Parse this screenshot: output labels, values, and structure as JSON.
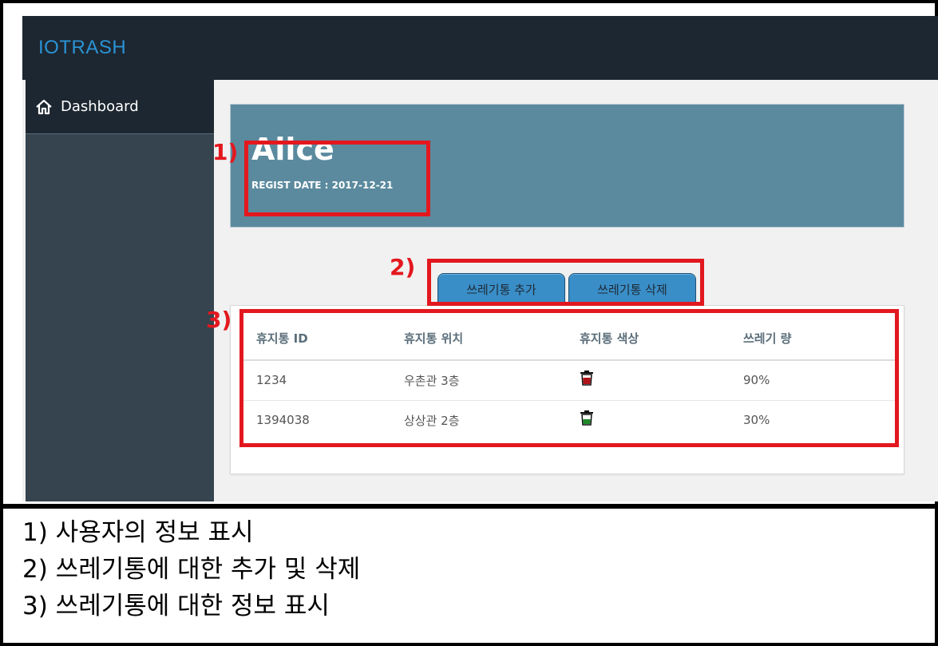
{
  "header": {
    "brand": "IOTRASH"
  },
  "sidebar": {
    "items": [
      {
        "label": "Dashboard",
        "icon": "home-icon"
      }
    ]
  },
  "profile": {
    "name": "Alice",
    "regist_date": "REGIST DATE : 2017-12-21"
  },
  "actions": {
    "add_label": "쓰레기통 추가",
    "delete_label": "쓰레기통 삭제"
  },
  "table": {
    "headers": [
      "휴지통 ID",
      "휴지통 위치",
      "휴지통 색상",
      "쓰레기 량"
    ],
    "rows": [
      {
        "id": "1234",
        "location": "우촌관 3층",
        "color_icon": "trash-bin-red-icon",
        "amount": "90%"
      },
      {
        "id": "1394038",
        "location": "상상관 2층",
        "color_icon": "trash-bin-green-icon",
        "amount": "30%"
      }
    ]
  },
  "annotations": {
    "labels": [
      "1)",
      "2)",
      "3)"
    ]
  },
  "legend": {
    "lines": [
      "1)  사용자의 정보 표시",
      "2)  쓰레기통에 대한 추가 및 삭제",
      "3)  쓰레기통에 대한 정보 표시"
    ]
  },
  "colors": {
    "topbar": "#1d2731",
    "sidebar": "#35444f",
    "brand": "#2a93d5",
    "profile_bg": "#5b8a9e",
    "tab_button": "#3a8ec7",
    "annotation_red": "#e3181f",
    "bin_red": "#b0131a",
    "bin_green": "#1f8a2c"
  }
}
